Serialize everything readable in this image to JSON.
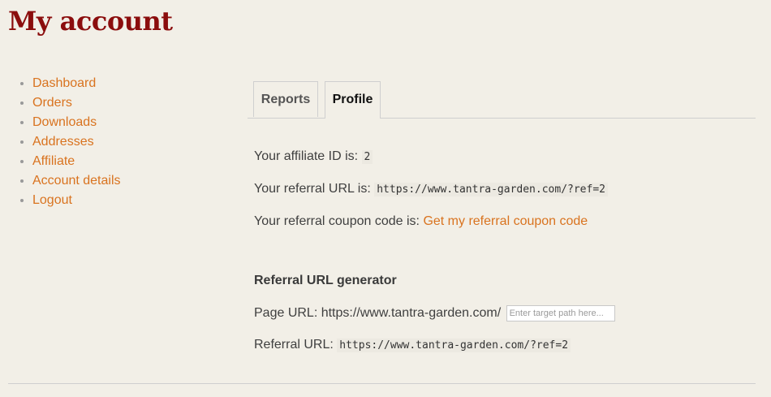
{
  "page": {
    "title": "My account"
  },
  "nav": {
    "items": [
      {
        "label": "Dashboard"
      },
      {
        "label": "Orders"
      },
      {
        "label": "Downloads"
      },
      {
        "label": "Addresses"
      },
      {
        "label": "Affiliate"
      },
      {
        "label": "Account details"
      },
      {
        "label": "Logout"
      }
    ]
  },
  "tabs": [
    {
      "label": "Reports",
      "active": false
    },
    {
      "label": "Profile",
      "active": true
    }
  ],
  "profile": {
    "affiliate_id_label": "Your affiliate ID is:",
    "affiliate_id": "2",
    "referral_url_label": "Your referral URL is:",
    "referral_url": "https://www.tantra-garden.com/?ref=2",
    "coupon_label": "Your referral coupon code is:",
    "coupon_link": "Get my referral coupon code"
  },
  "generator": {
    "title": "Referral URL generator",
    "page_url_label": "Page URL: https://www.tantra-garden.com/",
    "path_placeholder": "Enter target path here...",
    "referral_url_label": "Referral URL:",
    "referral_url": "https://www.tantra-garden.com/?ref=2"
  },
  "colors": {
    "title": "#8b0d0d",
    "link": "#d9731f",
    "background": "#f2efe7"
  }
}
